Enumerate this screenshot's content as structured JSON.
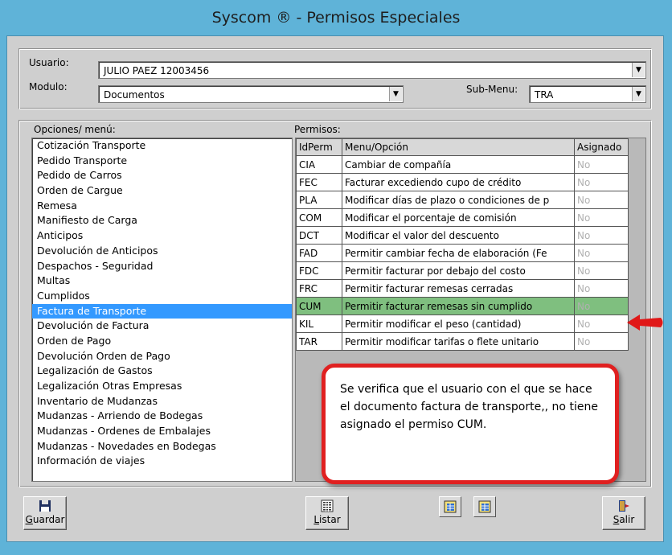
{
  "window": {
    "title": "Syscom ® - Permisos Especiales"
  },
  "header": {
    "usuario_label": "Usuario:",
    "usuario_value": "JULIO PAEZ 12003456",
    "modulo_label": "Modulo:",
    "modulo_value": "Documentos",
    "submenu_label": "Sub-Menu:",
    "submenu_value": "TRA"
  },
  "options": {
    "label": "Opciones/ menú:",
    "items": [
      "Cotización Transporte",
      "Pedido Transporte",
      "Pedido de Carros",
      "Orden de Cargue",
      "Remesa",
      "Manifiesto de Carga",
      "Anticipos",
      "Devolución de Anticipos",
      "Despachos - Seguridad",
      "Multas",
      "Cumplidos",
      "Factura de Transporte",
      "Devolución de Factura",
      "Orden de Pago",
      "Devolución Orden de Pago",
      "Legalización de Gastos",
      "Legalización Otras Empresas",
      "Inventario de Mudanzas",
      "Mudanzas - Arriendo de Bodegas",
      "Mudanzas - Ordenes de Embalajes",
      "Mudanzas - Novedades en Bodegas",
      "Información de viajes"
    ],
    "selected_index": 11
  },
  "permisos": {
    "label": "Permisos:",
    "columns": [
      "IdPerm",
      "Menu/Opción",
      "Asignado"
    ],
    "rows": [
      {
        "id": "CIA",
        "menu": "Cambiar de compañía",
        "asignado": "No"
      },
      {
        "id": "FEC",
        "menu": "Facturar excediendo cupo de crédito",
        "asignado": "No"
      },
      {
        "id": "PLA",
        "menu": "Modificar días de plazo o condiciones de p",
        "asignado": "No"
      },
      {
        "id": "COM",
        "menu": "Modificar el porcentaje de comisión",
        "asignado": "No"
      },
      {
        "id": "DCT",
        "menu": "Modificar el valor del descuento",
        "asignado": "No"
      },
      {
        "id": "FAD",
        "menu": "Permitir cambiar fecha de elaboración (Fe",
        "asignado": "No"
      },
      {
        "id": "FDC",
        "menu": "Permitir facturar por debajo del costo",
        "asignado": "No"
      },
      {
        "id": "FRC",
        "menu": "Permitir facturar remesas cerradas",
        "asignado": "No"
      },
      {
        "id": "CUM",
        "menu": "Permitir facturar remesas sin cumplido",
        "asignado": "No"
      },
      {
        "id": "KIL",
        "menu": "Permitir modificar el peso (cantidad)",
        "asignado": "No"
      },
      {
        "id": "TAR",
        "menu": "Permitir modificar tarifas o flete unitario",
        "asignado": "No"
      }
    ],
    "highlight_index": 8
  },
  "callout": {
    "text": "Se verifica que el usuario con el que se hace el documento factura de transporte,, no tiene asignado el permiso CUM."
  },
  "buttons": {
    "guardar_u": "G",
    "guardar_rest": "uardar",
    "listar_u": "L",
    "listar_rest": "istar",
    "salir_u": "S",
    "salir_rest": "alir"
  },
  "icons": {
    "guardar": "floppy-disk-icon",
    "listar": "list-icon",
    "salir": "exit-door-icon",
    "arrow": "red-arrow-icon"
  },
  "colors": {
    "title_bar": "#5fb3d8",
    "selection": "#3399ff",
    "highlight_row": "#7fbf7f",
    "callout_border": "#e02020"
  }
}
